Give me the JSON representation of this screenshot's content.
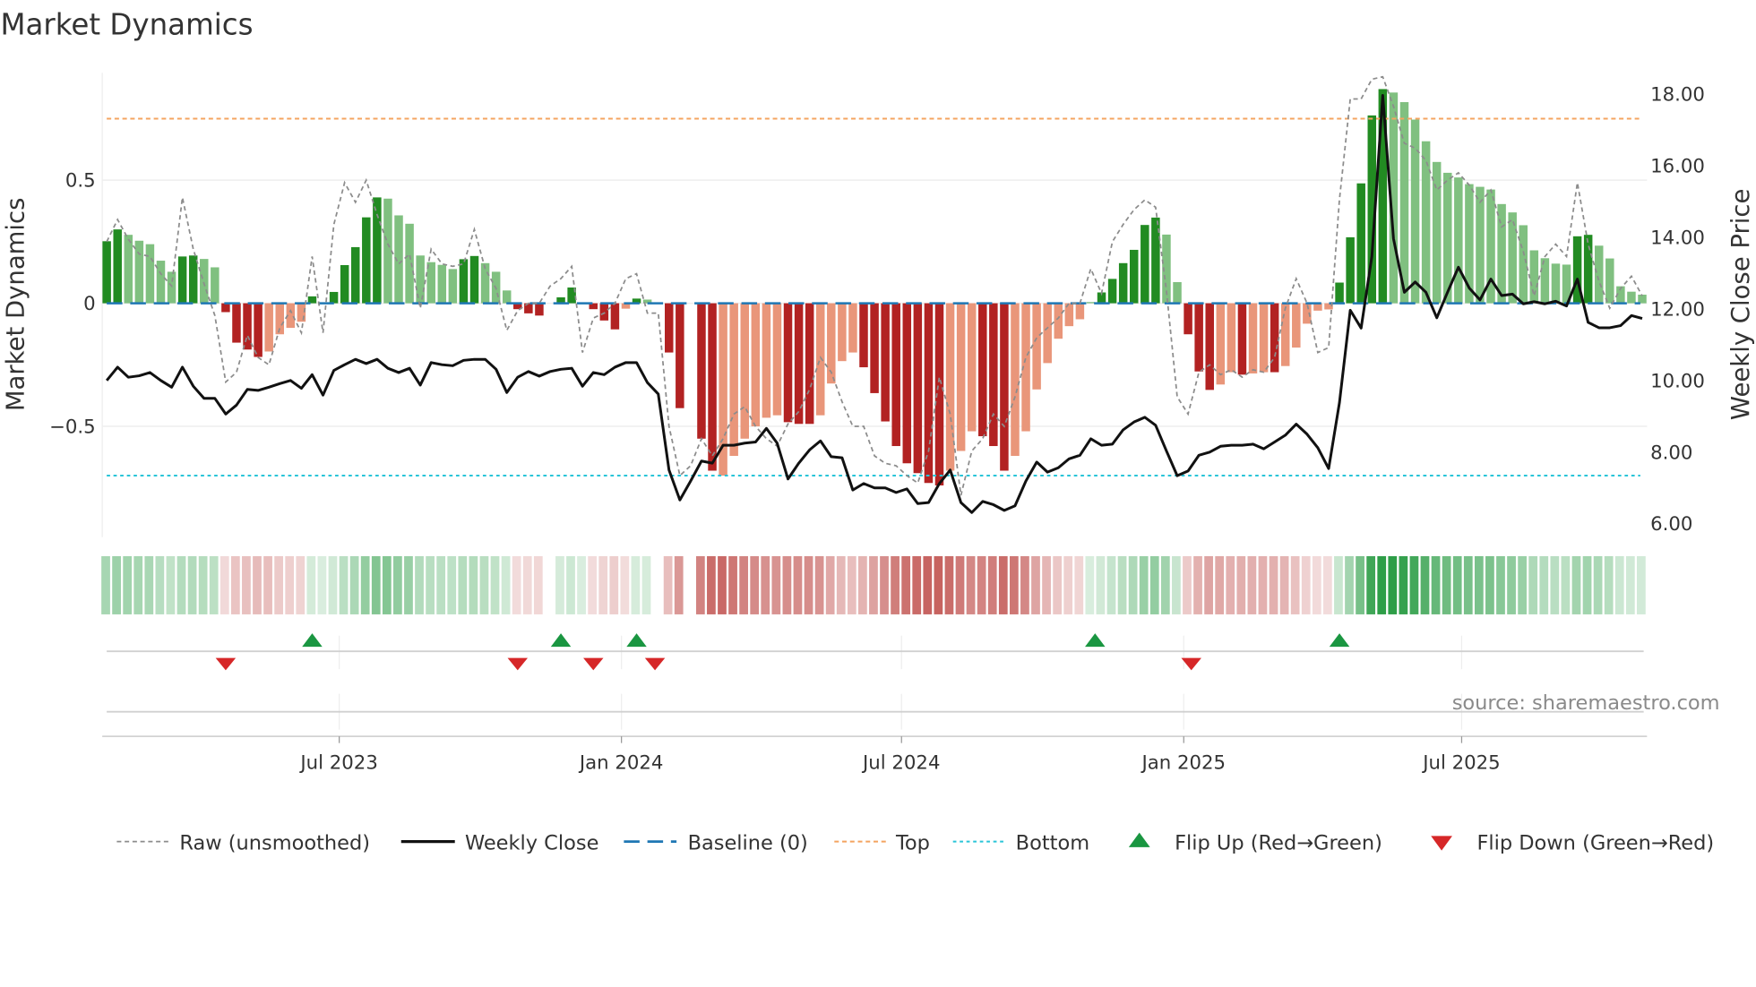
{
  "chart_data": {
    "type": "bar",
    "title": "Market Dynamics",
    "ylabel": "Market Dynamics",
    "y2label": "Weekly Close Price",
    "ylim": [
      -0.95,
      0.94
    ],
    "y2lim": [
      5.75,
      18.6
    ],
    "yticks": [
      "0.5",
      "0",
      "−0.5"
    ],
    "ytick_values": [
      0.5,
      0,
      -0.5
    ],
    "y2ticks": [
      "18.00",
      "16.00",
      "14.00",
      "12.00",
      "10.00",
      "8.00",
      "6.00"
    ],
    "y2tick_values": [
      18,
      16,
      14,
      12,
      10,
      8,
      6
    ],
    "xticks": [
      {
        "label": "Jul 2023",
        "week": 21.5
      },
      {
        "label": "Jan 2024",
        "week": 47.6
      },
      {
        "label": "Jul 2024",
        "week": 73.5
      },
      {
        "label": "Jan 2025",
        "week": 99.6
      },
      {
        "label": "Jul 2025",
        "week": 125.3
      }
    ],
    "top_level": 0.75,
    "bottom_level": -0.7,
    "baseline": 0,
    "momentum": [
      0.252,
      0.3,
      0.278,
      0.254,
      0.24,
      0.173,
      0.128,
      0.19,
      0.194,
      0.18,
      0.146,
      -0.036,
      -0.16,
      -0.188,
      -0.218,
      -0.196,
      -0.126,
      -0.1,
      -0.075,
      0.028,
      0.003,
      0.046,
      0.155,
      0.228,
      0.349,
      0.43,
      0.425,
      0.357,
      0.323,
      0.194,
      0.167,
      0.156,
      0.139,
      0.179,
      0.192,
      0.163,
      0.128,
      0.052,
      -0.024,
      -0.041,
      -0.05,
      0,
      0.024,
      0.064,
      0.003,
      -0.024,
      -0.07,
      -0.106,
      -0.022,
      0.019,
      0.015,
      0,
      -0.2,
      -0.426,
      0,
      -0.55,
      -0.68,
      -0.7,
      -0.62,
      -0.55,
      -0.5,
      -0.465,
      -0.455,
      -0.483,
      -0.49,
      -0.49,
      -0.455,
      -0.326,
      -0.235,
      -0.2,
      -0.26,
      -0.365,
      -0.48,
      -0.58,
      -0.65,
      -0.69,
      -0.73,
      -0.74,
      -0.68,
      -0.6,
      -0.52,
      -0.54,
      -0.58,
      -0.68,
      -0.62,
      -0.52,
      -0.35,
      -0.243,
      -0.144,
      -0.093,
      -0.065,
      0.005,
      0.044,
      0.099,
      0.163,
      0.217,
      0.318,
      0.348,
      0.279,
      0.086,
      -0.126,
      -0.277,
      -0.352,
      -0.33,
      -0.28,
      -0.29,
      -0.285,
      -0.28,
      -0.28,
      -0.255,
      -0.18,
      -0.083,
      -0.03,
      -0.025,
      0.084,
      0.268,
      0.487,
      0.763,
      0.87,
      0.856,
      0.817,
      0.746,
      0.658,
      0.574,
      0.53,
      0.511,
      0.484,
      0.473,
      0.462,
      0.403,
      0.369,
      0.317,
      0.215,
      0.183,
      0.161,
      0.157,
      0.272,
      0.278,
      0.234,
      0.182,
      0.069,
      0.047,
      0.035
    ],
    "rising": "DDLLLLLDDLLDDDDLLLLDLDDDDDLLLLLLLDDLLLDDDLDDLDDDLDLLDDLDDLLLLLLDDDLLLLDDDDDDDDLLLDDDLLLLLLLLDDDDDDLLDDDLLDLLDLLLLLDDDDDLLLLLLLLLLLLLLLLLDDLLLLL",
    "raw": [
      0.25,
      0.34,
      0.26,
      0.2,
      0.19,
      0.12,
      0.07,
      0.43,
      0.22,
      0.08,
      -0.05,
      -0.32,
      -0.28,
      -0.13,
      -0.22,
      -0.25,
      -0.1,
      -0.03,
      -0.12,
      0.19,
      -0.12,
      0.32,
      0.49,
      0.41,
      0.5,
      0.36,
      0.24,
      0.16,
      0.2,
      -0.02,
      0.22,
      0.16,
      0.15,
      0.16,
      0.3,
      0.14,
      0.06,
      -0.11,
      -0.03,
      0.0,
      0.0,
      0.07,
      0.1,
      0.15,
      -0.2,
      -0.06,
      -0.04,
      0.0,
      0.1,
      0.12,
      -0.04,
      -0.04,
      -0.5,
      -0.7,
      -0.66,
      -0.55,
      -0.62,
      -0.55,
      -0.45,
      -0.42,
      -0.5,
      -0.55,
      -0.58,
      -0.49,
      -0.44,
      -0.35,
      -0.22,
      -0.28,
      -0.4,
      -0.5,
      -0.5,
      -0.62,
      -0.65,
      -0.66,
      -0.7,
      -0.73,
      -0.6,
      -0.3,
      -0.45,
      -0.78,
      -0.6,
      -0.55,
      -0.45,
      -0.5,
      -0.38,
      -0.22,
      -0.14,
      -0.1,
      -0.06,
      0.0,
      0.0,
      0.14,
      0.04,
      0.25,
      0.32,
      0.38,
      0.42,
      0.39,
      0.05,
      -0.38,
      -0.45,
      -0.28,
      -0.25,
      -0.29,
      -0.27,
      -0.3,
      -0.27,
      -0.28,
      -0.22,
      -0.02,
      0.1,
      0.0,
      -0.2,
      -0.18,
      0.42,
      0.83,
      0.83,
      0.91,
      0.92,
      0.8,
      0.65,
      0.63,
      0.58,
      0.46,
      0.5,
      0.53,
      0.48,
      0.41,
      0.46,
      0.31,
      0.34,
      0.21,
      0.03,
      0.19,
      0.24,
      0.19,
      0.49,
      0.24,
      0.09,
      -0.02,
      0.06,
      0.11,
      0.03
    ],
    "close": [
      9.97,
      10.34,
      10.06,
      10.1,
      10.19,
      9.97,
      9.78,
      10.34,
      9.81,
      9.47,
      9.47,
      9.03,
      9.28,
      9.72,
      9.69,
      9.78,
      9.88,
      9.97,
      9.75,
      10.13,
      9.56,
      10.25,
      10.41,
      10.56,
      10.44,
      10.56,
      10.31,
      10.19,
      10.31,
      9.84,
      10.47,
      10.41,
      10.38,
      10.53,
      10.56,
      10.56,
      10.28,
      9.63,
      10.06,
      10.22,
      10.09,
      10.22,
      10.28,
      10.31,
      9.81,
      10.19,
      10.13,
      10.34,
      10.47,
      10.47,
      9.91,
      9.59,
      7.47,
      6.63,
      7.16,
      7.72,
      7.66,
      8.16,
      8.16,
      8.22,
      8.25,
      8.63,
      8.22,
      7.22,
      7.66,
      8.03,
      8.28,
      7.84,
      7.81,
      6.91,
      7.09,
      6.97,
      6.97,
      6.84,
      6.94,
      6.53,
      6.56,
      7.09,
      7.47,
      6.56,
      6.28,
      6.59,
      6.5,
      6.34,
      6.47,
      7.16,
      7.69,
      7.41,
      7.53,
      7.78,
      7.88,
      8.34,
      8.16,
      8.19,
      8.59,
      8.81,
      8.94,
      8.72,
      8.0,
      7.31,
      7.44,
      7.88,
      7.97,
      8.13,
      8.16,
      8.16,
      8.19,
      8.06,
      8.25,
      8.44,
      8.75,
      8.47,
      8.09,
      7.51,
      9.34,
      11.93,
      11.43,
      13.43,
      17.93,
      13.93,
      12.43,
      12.72,
      12.43,
      11.72,
      12.43,
      13.13,
      12.55,
      12.22,
      12.8,
      12.34,
      12.38,
      12.11,
      12.17,
      12.11,
      12.18,
      12.05,
      12.8,
      11.59,
      11.44,
      11.44,
      11.5,
      11.78,
      11.7
    ],
    "flip_up_weeks": [
      19,
      42,
      49,
      91.4,
      114
    ],
    "flip_down_weeks": [
      11,
      38,
      45,
      50.7,
      100.3
    ],
    "legend_position": "bottom",
    "legend": {
      "raw": "Raw (unsmoothed)",
      "close": "Weekly Close",
      "baseline": "Baseline (0)",
      "top": "Top",
      "bottom": "Bottom",
      "flip_up": "Flip Up (Red→Green)",
      "flip_down": "Flip Down (Green→Red)"
    },
    "source": "source: sharemaestro.com",
    "colors": {
      "green_dark": "#228b22",
      "green_light": "#80c080",
      "red_dark": "#b22222",
      "red_light": "#e9967a",
      "raw": "#8c8c8c",
      "close": "#111111",
      "baseline": "#1f77b4",
      "top": "#f4a460",
      "bottom": "#29c4d8",
      "flip_up": "#1a9641",
      "flip_down": "#d62728"
    }
  }
}
